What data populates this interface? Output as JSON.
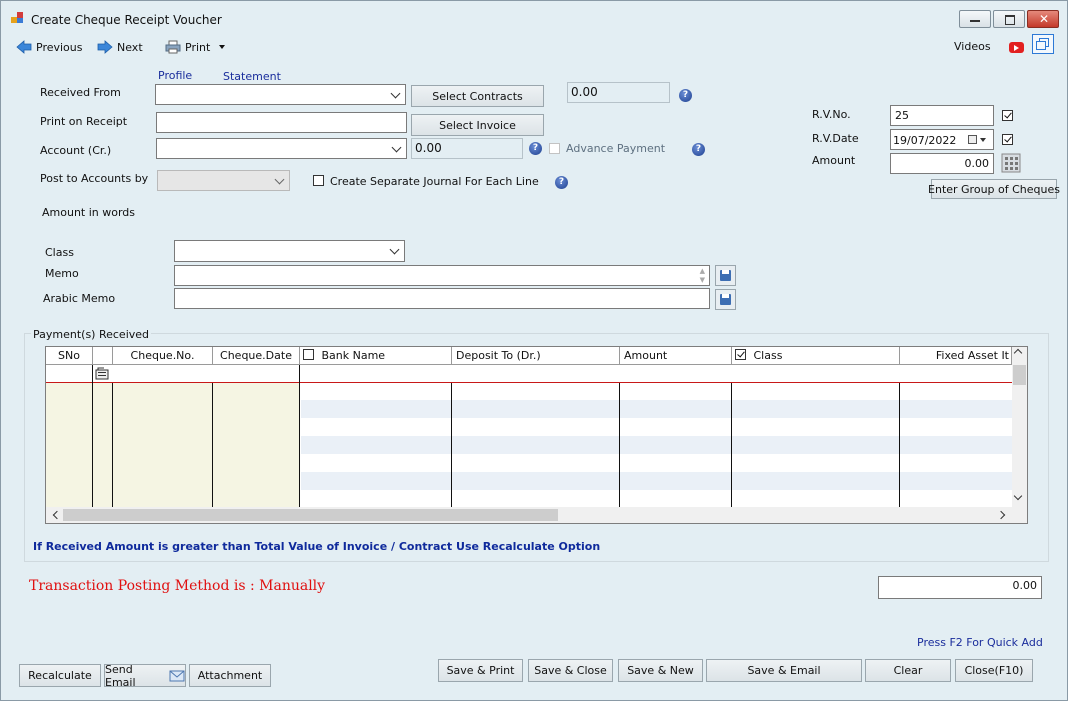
{
  "window": {
    "title": "Create Cheque Receipt Voucher"
  },
  "toolbar": {
    "previous": "Previous",
    "next": "Next",
    "print": "Print",
    "videos": "Videos"
  },
  "links": {
    "profile": "Profile",
    "statement": "Statement",
    "quick_add": "Press F2 For Quick Add"
  },
  "form": {
    "received_from_label": "Received From",
    "print_on_receipt_label": "Print on Receipt",
    "account_label": "Account (Cr.)",
    "post_label": "Post to Accounts by",
    "amount_words_label": "Amount in words",
    "class_label": "Class",
    "memo_label": "Memo",
    "arabic_memo_label": "Arabic Memo",
    "select_contracts": "Select Contracts",
    "select_invoice": "Select Invoice",
    "contracts_value": "0.00",
    "account_value": "0.00",
    "advance_payment": "Advance Payment",
    "separate_journal": "Create Separate Journal For Each Line"
  },
  "right": {
    "rv_no_label": "R.V.No.",
    "rv_no": "25",
    "rv_date_label": "R.V.Date",
    "rv_date": "19/07/2022",
    "amount_label": "Amount",
    "amount": "0.00",
    "enter_group": "Enter Group of Cheques"
  },
  "grid": {
    "group_label": "Payment(s) Received",
    "columns": [
      "SNo",
      "",
      "Cheque.No.",
      "Cheque.Date",
      "Bank Name",
      "Deposit To (Dr.)",
      "Amount",
      "Class",
      "Fixed Asset It"
    ]
  },
  "notice": "If Received Amount is greater than Total Value of Invoice / Contract Use Recalculate Option",
  "posting_method": "Transaction Posting Method is : Manually",
  "total": "0.00",
  "buttons": {
    "recalculate": "Recalculate",
    "send_email": "Send Email",
    "attachment": "Attachment",
    "save_print": "Save & Print",
    "save_close": "Save & Close",
    "save_new": "Save & New",
    "save_email": "Save & Email",
    "clear": "Clear",
    "close": "Close(F10)"
  },
  "colors": {
    "background": "#e3eef3",
    "link": "#1a2d9c",
    "posting": "#e01010",
    "notice": "#0f2a9c",
    "grid_frozen": "#f5f5e3"
  },
  "icons": [
    "app-icon",
    "previous-icon",
    "next-icon",
    "printer-icon",
    "youtube-icon",
    "restore-window-icon",
    "help-icon",
    "calendar-icon",
    "calculator-icon",
    "save-icon",
    "email-icon"
  ]
}
